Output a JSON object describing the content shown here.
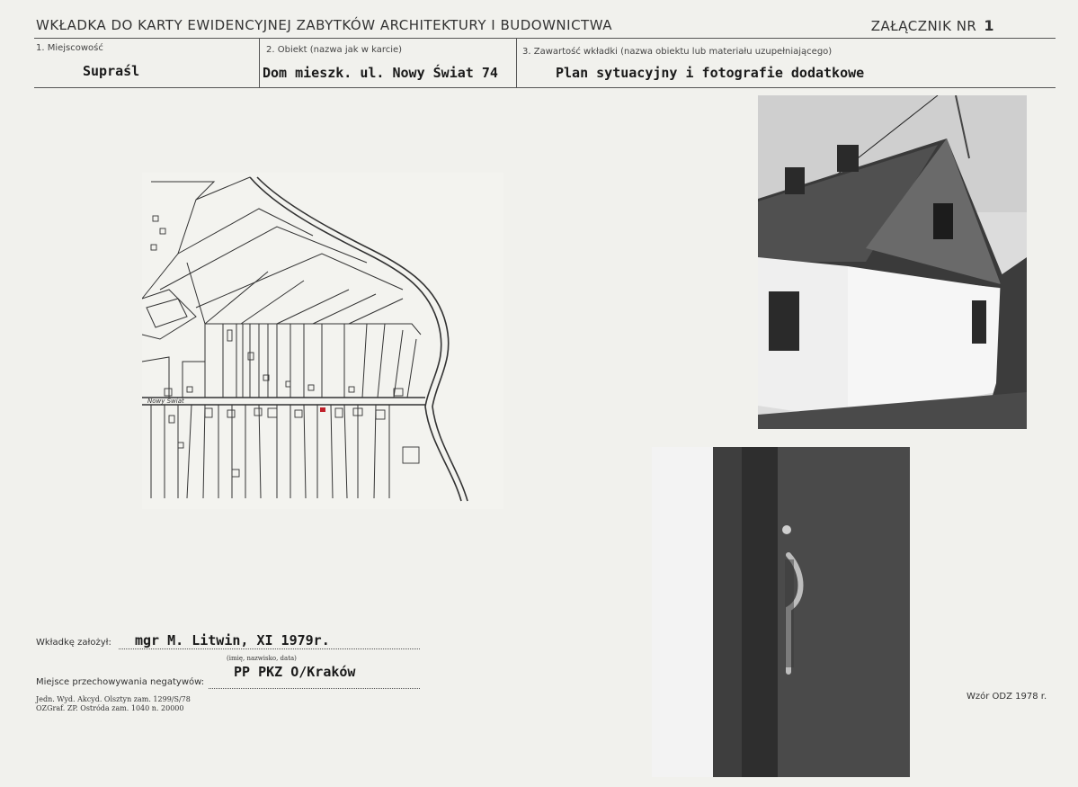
{
  "header": {
    "title": "WKŁADKA DO KARTY EWIDENCYJNEJ ZABYTKÓW ARCHITEKTURY I BUDOWNICTWA",
    "annex_label": "ZAŁĄCZNIK NR",
    "annex_number": "1"
  },
  "fields": {
    "place_label": "1. Miejscowość",
    "place_value": "Supraśl",
    "object_label": "2. Obiekt (nazwa jak w karcie)",
    "object_value": "Dom mieszk. ul. Nowy Świat 74",
    "content_label": "3. Zawartość wkładki (nazwa obiektu lub materiału uzupełniającego)",
    "content_value": "Plan sytuacyjny i fotografie dodatkowe"
  },
  "map": {
    "street_label": "Nowy Świat"
  },
  "footer": {
    "author_label": "Wkładkę założył:",
    "author_value": "mgr M. Litwin, XI 1979r.",
    "author_hint": "(imię, nazwisko, data)",
    "negatives_label": "Miejsce przechowywania negatywów:",
    "negatives_value": "PP PKZ O/Kraków",
    "print_line1": "Jedn. Wyd. Akcyd. Olsztyn zam. 1299/S/78",
    "print_line2": "OZGraf. ZP. Ostróda zam. 1040 n. 20000",
    "form_model": "Wzór ODZ 1978 r."
  }
}
